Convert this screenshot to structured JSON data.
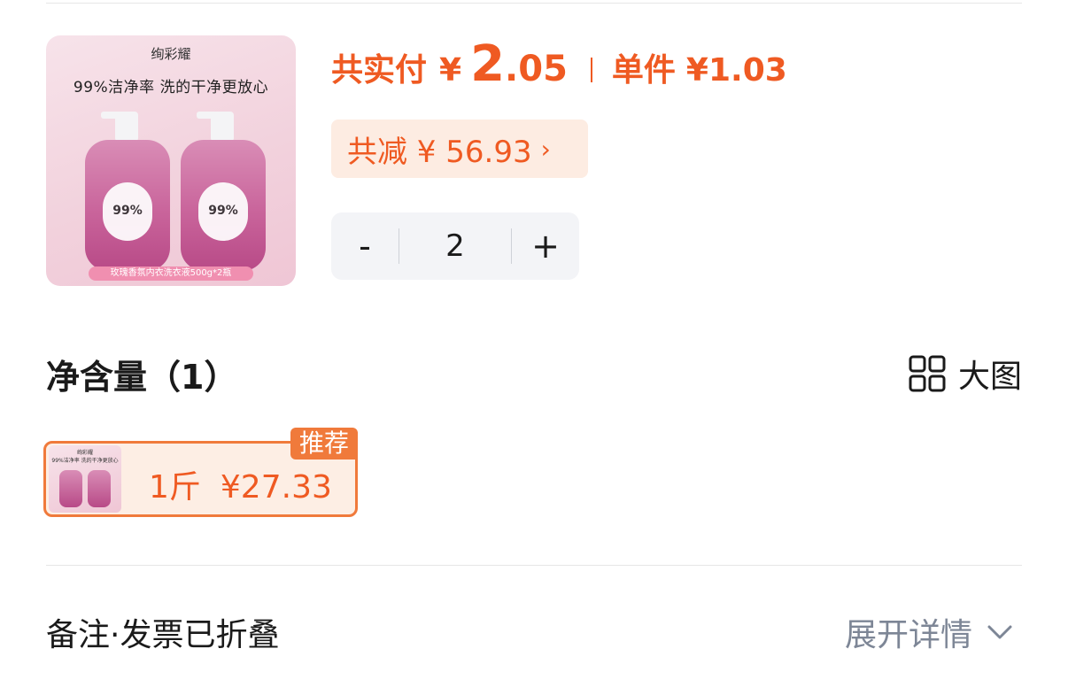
{
  "product": {
    "image_brand": "绚彩耀",
    "image_slogan": "99%洁净率 洗的干净更放心",
    "image_badge": "99%",
    "image_footer": "玫瑰香氛内衣洗衣液500g*2瓶"
  },
  "price": {
    "pay_label": "共实付",
    "currency": "¥",
    "pay_integer": "2",
    "pay_decimal": ".05",
    "unit_label": "单件",
    "unit_price": "¥1.03",
    "accent_color": "#ef5a22"
  },
  "discount": {
    "label": "共减 ¥ 56.93",
    "chevron": "›"
  },
  "quantity": {
    "minus": "-",
    "value": "2",
    "plus": "+"
  },
  "spec_section": {
    "title": "净含量（1）",
    "big_view_label": "大图",
    "big_view_icon": "grid-icon",
    "options": [
      {
        "size": "1斤",
        "price": "¥27.33",
        "badge": "推荐",
        "selected": true
      }
    ]
  },
  "notes": {
    "label": "备注·发票已折叠",
    "expand_label": "展开详情",
    "expand_icon": "chevron-down-icon"
  }
}
